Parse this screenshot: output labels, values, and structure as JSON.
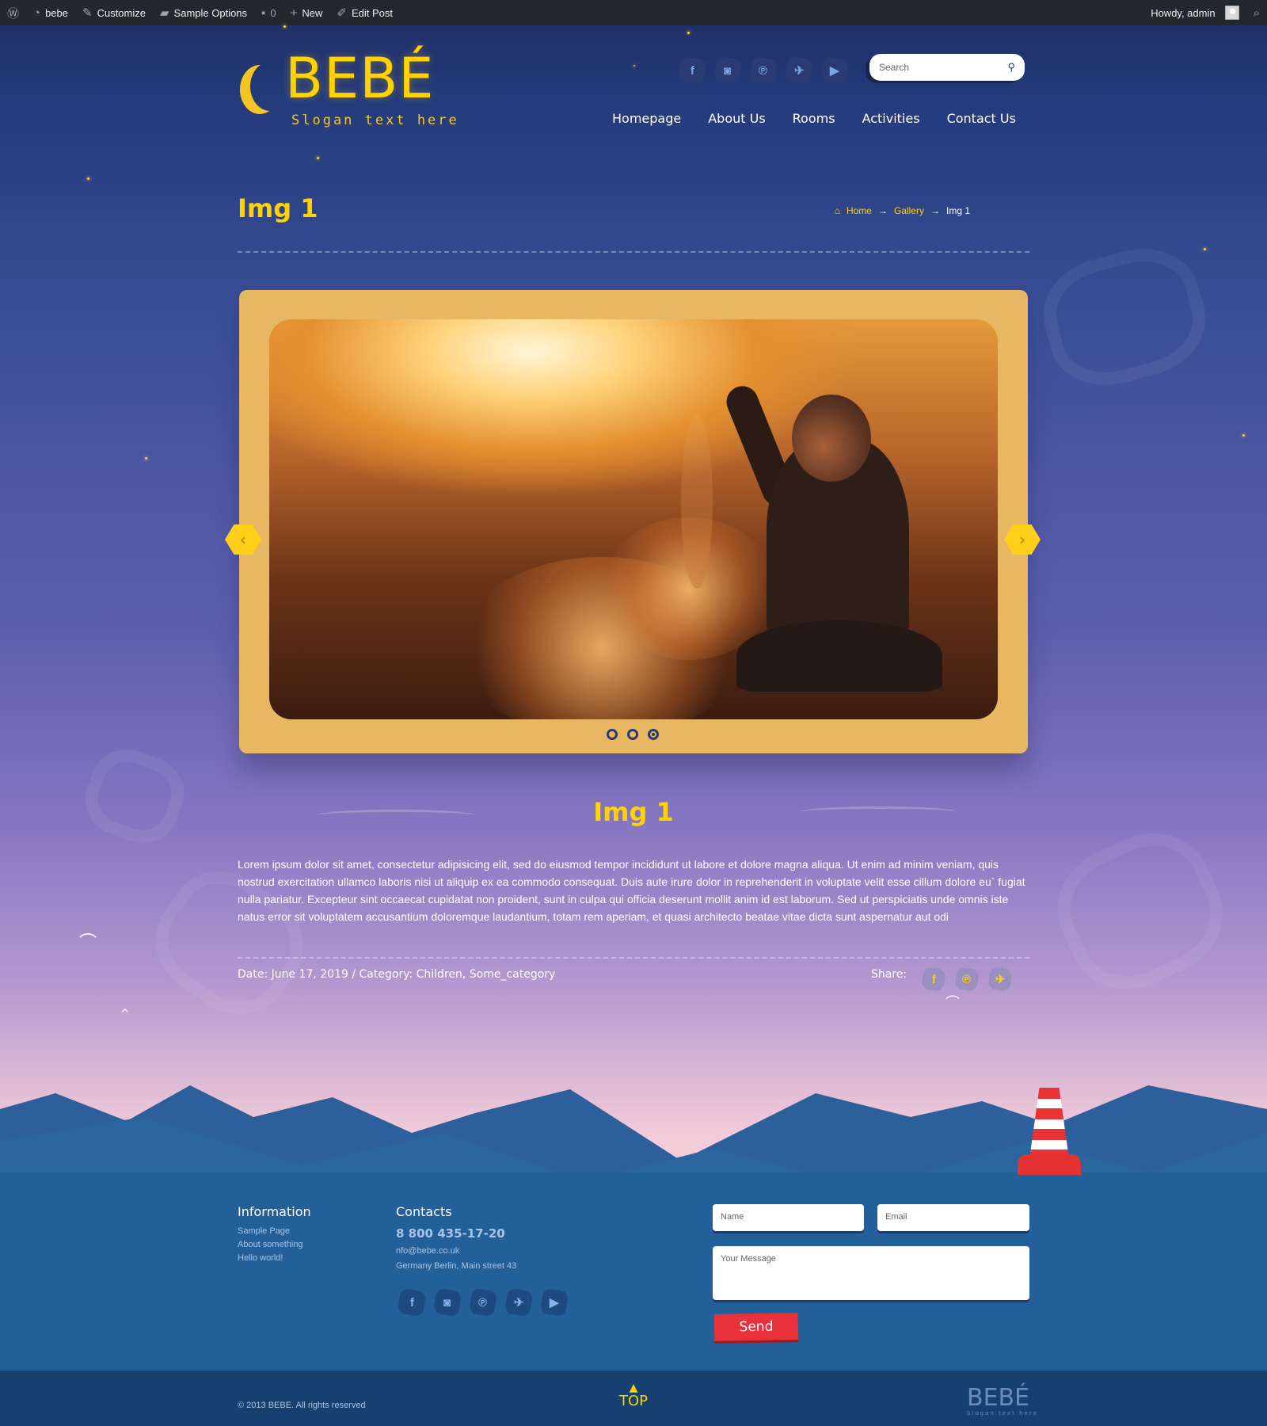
{
  "admin_bar": {
    "site": "bebe",
    "customize": "Customize",
    "sample_options": "Sample Options",
    "comments_count": "0",
    "new": "New",
    "edit_post": "Edit Post",
    "howdy": "Howdy, admin"
  },
  "header": {
    "logo_text": "BEBÉ",
    "slogan": "Slogan text here",
    "search_placeholder": "Search",
    "social": [
      {
        "icon": "facebook-icon",
        "glyph": "f"
      },
      {
        "icon": "instagram-icon",
        "glyph": "◙"
      },
      {
        "icon": "pinterest-icon",
        "glyph": "℗"
      },
      {
        "icon": "twitter-icon",
        "glyph": "✈"
      },
      {
        "icon": "youtube-icon",
        "glyph": "▶"
      }
    ],
    "nav": [
      "Homepage",
      "About Us",
      "Rooms",
      "Activities",
      "Contact Us"
    ]
  },
  "page": {
    "title": "Img 1",
    "breadcrumb": {
      "home": "Home",
      "gallery": "Gallery",
      "current": "Img 1",
      "separator": "→"
    }
  },
  "slider": {
    "slide_count": 3,
    "active_slide": 3,
    "prev_glyph": "‹",
    "next_glyph": "›"
  },
  "post": {
    "title": "Img 1",
    "body": "Lorem ipsum dolor sit amet, consectetur adipisicing elit, sed do eiusmod tempor incididunt ut labore et dolore magna aliqua. Ut enim ad minim veniam, quis nostrud exercitation ullamco laboris nisi ut aliquip ex ea commodo consequat. Duis aute irure dolor in reprehenderit in voluptate velit esse cillum dolore eu` fugiat nulla pariatur. Excepteur sint occaecat cupidatat non proident, sunt in culpa qui officia deserunt mollit anim id est laborum. Sed ut perspiciatis unde omnis iste natus error sit voluptatem accusantium doloremque laudantium, totam rem aperiam, et quasi architecto beatae vitae dicta sunt aspernatur aut odi",
    "meta": "Date: June 17, 2019 / Category: Children, Some_category",
    "share_label": "Share:"
  },
  "footer": {
    "information_heading": "Information",
    "links": [
      "Sample Page",
      "About something",
      "Hello world!"
    ],
    "contacts_heading": "Contacts",
    "phone": "8 800 435-17-20",
    "email": "nfo@bebe.co.uk",
    "address": "Germany Berlin, Main street 43",
    "form": {
      "name_placeholder": "Name",
      "email_placeholder": "Email",
      "message_placeholder": "Your Message",
      "send_label": "Send"
    },
    "copyright": "© 2013 BEBE. All rights reserved",
    "top_label": "TOP",
    "logo_text": "BEBÉ",
    "logo_slogan": "Slogan text here"
  },
  "colors": {
    "accent_yellow": "#ffd200",
    "frame": "#e8b764",
    "send_red": "#e8313a",
    "admin_bar": "#23282d"
  }
}
